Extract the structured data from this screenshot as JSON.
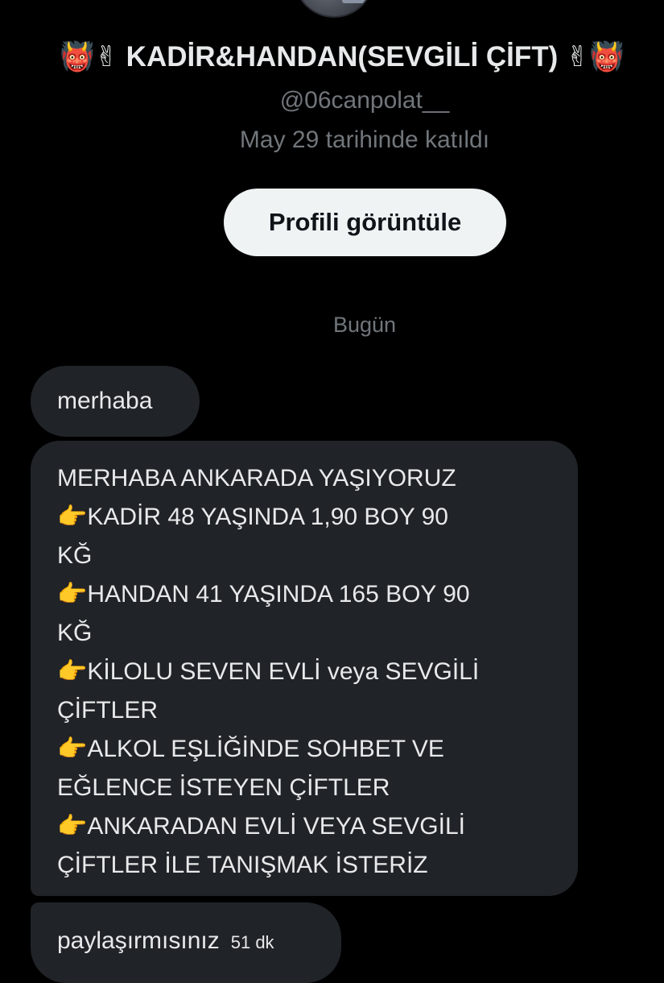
{
  "profile": {
    "name_prefix_emoji": "👹✌",
    "name": "KADİR&HANDAN(SEVGİLİ ÇİFT)",
    "name_suffix_emoji": "✌👹",
    "handle": "@06canpolat__",
    "joined": "May 29 tarihinde katıldı",
    "view_profile_label": "Profili görüntüle"
  },
  "conversation": {
    "date_divider": "Bugün",
    "messages": [
      {
        "text": "merhaba"
      },
      {
        "lines": [
          "MERHABA  ANKARADA  YAŞIYORUZ",
          "KADİR  48  YAŞINDA 1,90 BOY 90",
          "KĞ",
          "HANDAN  41 YAŞINDA 165 BOY  90",
          "KĞ",
          "KİLOLU SEVEN EVLİ veya SEVGİLİ",
          "ÇİFTLER",
          "ALKOL  EŞLİĞİNDE SOHBET VE",
          "EĞLENCE İSTEYEN  ÇİFTLER",
          "ANKARADAN EVLİ VEYA  SEVGİLİ",
          "ÇİFTLER  İLE  TANIŞMAK İSTERİZ"
        ],
        "bullet_icon": "👉"
      },
      {
        "text": "paylaşırmısınız",
        "timestamp": "51 dk"
      }
    ]
  },
  "colors": {
    "background": "#000000",
    "bubble": "#202327",
    "primary_text": "#e7e9ea",
    "secondary_text": "#71767b",
    "button_bg": "#eff3f4",
    "button_text": "#0f1419"
  }
}
